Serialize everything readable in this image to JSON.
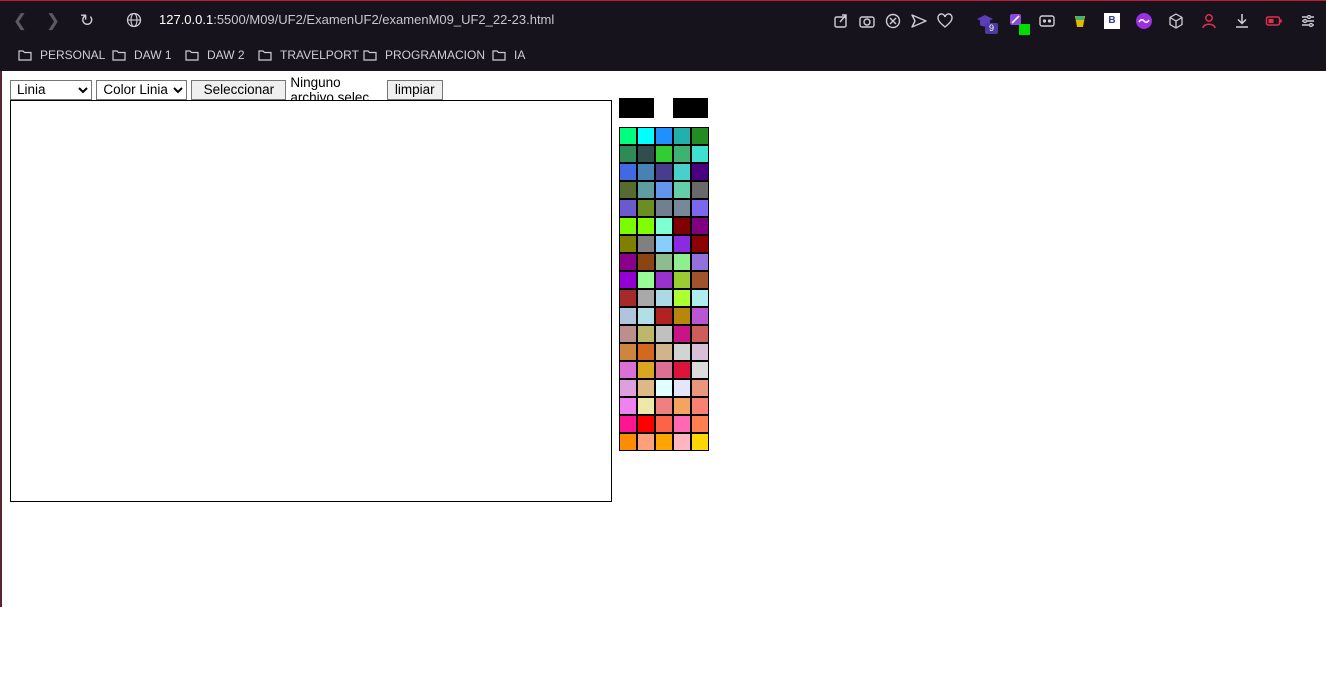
{
  "browser": {
    "url_host": "127.0.0.1",
    "url_path": ":5500/M09/UF2/ExamenUF2/examenM09_UF2_22-23.html",
    "extension_badge": "9",
    "bookmarks": [
      "PERSONAL",
      "DAW 1",
      "DAW 2",
      "TRAVELPORT",
      "PROGRAMACION",
      "IA"
    ]
  },
  "toolbar": {
    "line_select": "Linia",
    "color_select": "Color Linia",
    "file_button": "Seleccionar archivo",
    "file_status": "Ninguno archivo selec.",
    "clear_button": "limpiar"
  },
  "palette": {
    "selected_colors": [
      "#000000",
      "#000000"
    ],
    "colors": [
      "#00ff7f",
      "#00ffff",
      "#1e90ff",
      "#20b2aa",
      "#228b22",
      "#2e8b57",
      "#2f4f4f",
      "#32cd32",
      "#3cb371",
      "#40e0d0",
      "#4169e1",
      "#4682b4",
      "#483d8b",
      "#48d1cc",
      "#4b0082",
      "#556b2f",
      "#5f9ea0",
      "#6495ed",
      "#66cdaa",
      "#696969",
      "#6a5acd",
      "#6b8e23",
      "#708090",
      "#778899",
      "#7b68ee",
      "#7cfc00",
      "#7fff00",
      "#7fffd4",
      "#800000",
      "#800080",
      "#808000",
      "#808080",
      "#87cefa",
      "#8a2be2",
      "#8b0000",
      "#8b008b",
      "#8b4513",
      "#8fbc8f",
      "#90ee90",
      "#9370db",
      "#9400d3",
      "#98fb98",
      "#9932cc",
      "#9acd32",
      "#a0522d",
      "#a52a2a",
      "#a9a9a9",
      "#add8e6",
      "#adff2f",
      "#afeeee",
      "#b0c4de",
      "#b0e0e6",
      "#b22222",
      "#b8860b",
      "#ba55d3",
      "#bc8f8f",
      "#bdb76b",
      "#c0c0c0",
      "#c71585",
      "#cd5c5c",
      "#cd853f",
      "#d2691e",
      "#d2b48c",
      "#d3d3d3",
      "#d8bfd8",
      "#da70d6",
      "#daa520",
      "#db7093",
      "#dc143c",
      "#dcdcdc",
      "#dda0dd",
      "#deb887",
      "#e0ffff",
      "#e6e6fa",
      "#e9967a",
      "#ee82ee",
      "#eee8aa",
      "#f08080",
      "#f4a460",
      "#fa8072",
      "#ff1493",
      "#ff0000",
      "#ff6347",
      "#ff69b4",
      "#ff7f50",
      "#ff8c00",
      "#ffa07a",
      "#ffa500",
      "#ffb6c1",
      "#ffd700"
    ]
  }
}
